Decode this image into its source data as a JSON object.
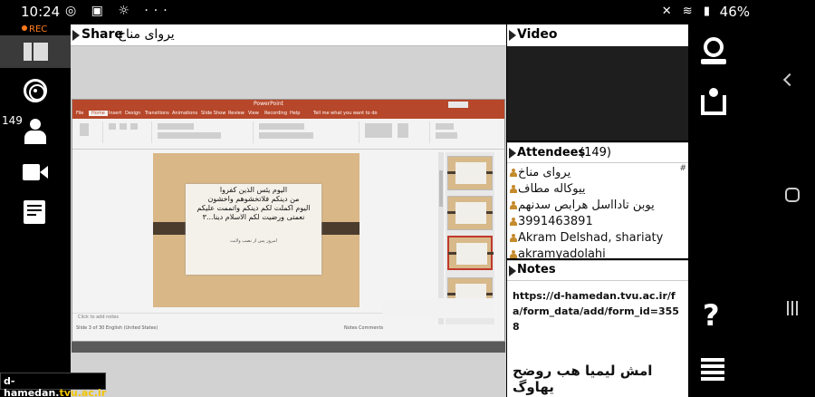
{
  "statusbar": {
    "time": "10:24",
    "left_icons": "◎ ▣ ☼ ···",
    "right_icons": "✕ 📶 ▐",
    "battery": "46%"
  },
  "left_toolbar": {
    "rec_label": "REC",
    "attendee_count": "149"
  },
  "share": {
    "title": "Share",
    "subtitle": "یروای مناخ",
    "ppt": {
      "app_name": "PowerPoint",
      "tabs": [
        "File",
        "Home",
        "Insert",
        "Design",
        "Transitions",
        "Animations",
        "Slide Show",
        "Review",
        "View",
        "Recording",
        "Help",
        "Tell me what you want to do"
      ],
      "slide_verse": "اليوم يئس الذين كفروا\nمن دينكم فلاتخشوهم واخشون\nاليوم اكملت لكم دينكم واتممت عليكم\nنعمتى ورضيت لكم الاسلام دينا...٣",
      "slide_sub": "امروز پس از نصب ولايت",
      "notes_placeholder": "Click to add notes",
      "status_left": "Slide 3 of 30   English (United States)",
      "status_right": "Notes   Comments"
    }
  },
  "video": {
    "title": "Video"
  },
  "attendees": {
    "title": "Attendees",
    "count": "(149)",
    "hash": "#",
    "items": [
      "یروای مناخ",
      "ییوکاله مطاف",
      "یوبن تادااسل هرابص سدنهم",
      "3991463891",
      "Akram Delshad, shariaty",
      "akramyadolahi"
    ]
  },
  "notes": {
    "title": "Notes",
    "url": "https://d-hamedan.tvu.ac.ir/fa/form_data/add/form_id=3558",
    "persian_line": "امش لیمیا هب روضح یهاوگ"
  },
  "watermark": {
    "prefix": "d-hamedan.",
    "highlight": "tvu.ac.ir"
  }
}
